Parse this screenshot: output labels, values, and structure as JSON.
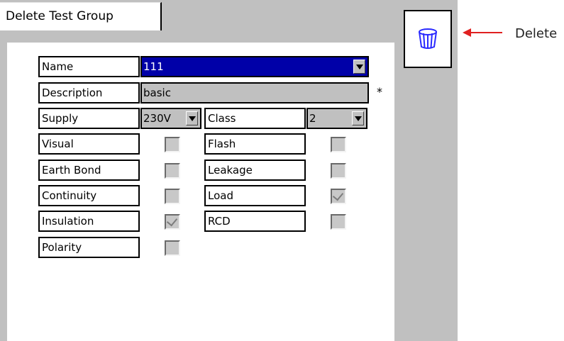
{
  "tab": {
    "label": "Delete Test Group"
  },
  "form": {
    "name_label": "Name",
    "name_value": "111",
    "description_label": "Description",
    "description_value": "basic",
    "required_marker": "*",
    "supply_label": "Supply",
    "supply_value": "230V",
    "class_label": "Class",
    "class_value": "2",
    "tests": [
      {
        "label": "Visual",
        "checked": false
      },
      {
        "label": "Earth Bond",
        "checked": false
      },
      {
        "label": "Continuity",
        "checked": false
      },
      {
        "label": "Insulation",
        "checked": true
      },
      {
        "label": "Polarity",
        "checked": false
      },
      {
        "label": "Flash",
        "checked": false
      },
      {
        "label": "Leakage",
        "checked": false
      },
      {
        "label": "Load",
        "checked": true
      },
      {
        "label": "RCD",
        "checked": false
      }
    ]
  },
  "side": {
    "delete_icon": "trash-icon"
  },
  "annotation": {
    "label": "Delete",
    "color": "#e02020"
  },
  "colors": {
    "selected_field": "#0000a8",
    "panel": "#c0c0c0"
  }
}
